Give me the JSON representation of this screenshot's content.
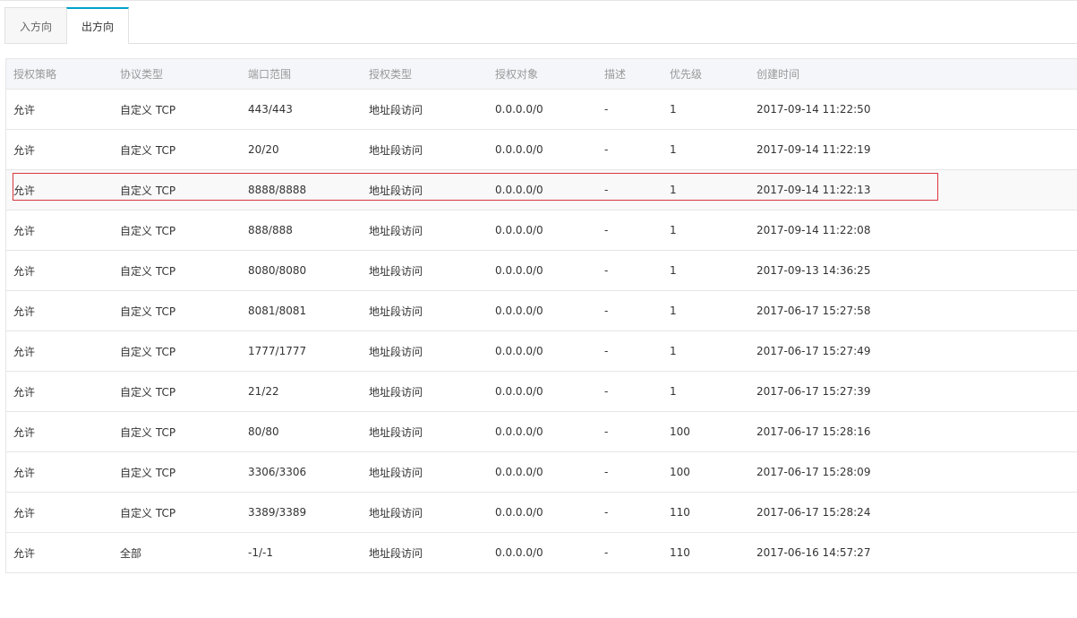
{
  "tabs": [
    {
      "label": "入方向",
      "active": false
    },
    {
      "label": "出方向",
      "active": true
    }
  ],
  "table": {
    "headers": [
      "授权策略",
      "协议类型",
      "端口范围",
      "授权类型",
      "授权对象",
      "描述",
      "优先级",
      "创建时间"
    ],
    "rows": [
      [
        "允许",
        "自定义 TCP",
        "443/443",
        "地址段访问",
        "0.0.0.0/0",
        "-",
        "1",
        "2017-09-14 11:22:50"
      ],
      [
        "允许",
        "自定义 TCP",
        "20/20",
        "地址段访问",
        "0.0.0.0/0",
        "-",
        "1",
        "2017-09-14 11:22:19"
      ],
      [
        "允许",
        "自定义 TCP",
        "8888/8888",
        "地址段访问",
        "0.0.0.0/0",
        "-",
        "1",
        "2017-09-14 11:22:13"
      ],
      [
        "允许",
        "自定义 TCP",
        "888/888",
        "地址段访问",
        "0.0.0.0/0",
        "-",
        "1",
        "2017-09-14 11:22:08"
      ],
      [
        "允许",
        "自定义 TCP",
        "8080/8080",
        "地址段访问",
        "0.0.0.0/0",
        "-",
        "1",
        "2017-09-13 14:36:25"
      ],
      [
        "允许",
        "自定义 TCP",
        "8081/8081",
        "地址段访问",
        "0.0.0.0/0",
        "-",
        "1",
        "2017-06-17 15:27:58"
      ],
      [
        "允许",
        "自定义 TCP",
        "1777/1777",
        "地址段访问",
        "0.0.0.0/0",
        "-",
        "1",
        "2017-06-17 15:27:49"
      ],
      [
        "允许",
        "自定义 TCP",
        "21/22",
        "地址段访问",
        "0.0.0.0/0",
        "-",
        "1",
        "2017-06-17 15:27:39"
      ],
      [
        "允许",
        "自定义 TCP",
        "80/80",
        "地址段访问",
        "0.0.0.0/0",
        "-",
        "100",
        "2017-06-17 15:28:16"
      ],
      [
        "允许",
        "自定义 TCP",
        "3306/3306",
        "地址段访问",
        "0.0.0.0/0",
        "-",
        "100",
        "2017-06-17 15:28:09"
      ],
      [
        "允许",
        "自定义 TCP",
        "3389/3389",
        "地址段访问",
        "0.0.0.0/0",
        "-",
        "110",
        "2017-06-17 15:28:24"
      ],
      [
        "允许",
        "全部",
        "-1/-1",
        "地址段访问",
        "0.0.0.0/0",
        "-",
        "110",
        "2017-06-16 14:57:27"
      ]
    ]
  },
  "colors": {
    "tab_accent": "#00a2ca",
    "highlight_border": "#d9363e",
    "header_bg": "#f5f6fa"
  }
}
